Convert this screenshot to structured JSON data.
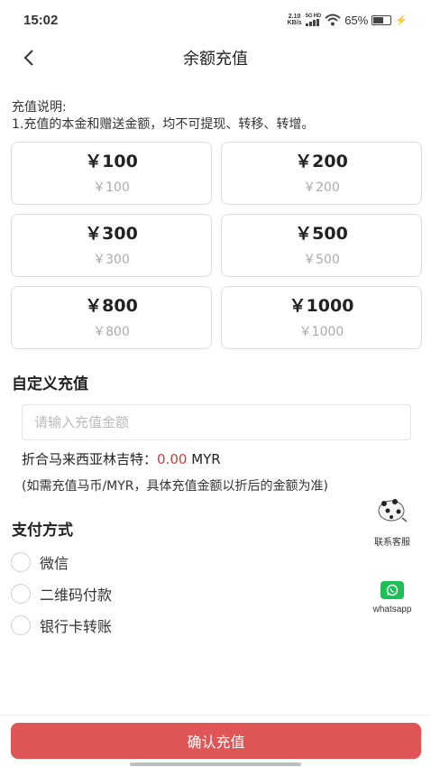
{
  "status_bar": {
    "time": "15:02",
    "net_speed_value": "2.10",
    "net_speed_unit": "KB/s",
    "net_type_top": "5G",
    "net_type_sub": "HD",
    "battery_text": "65%",
    "battery_level": 0.65
  },
  "nav": {
    "back_icon": "chevron-left-icon",
    "title": "余额充值"
  },
  "notice": {
    "heading": "充值说明:",
    "line1": "1.充值的本金和赠送金额，均不可提现、转移、转增。"
  },
  "amounts": [
    {
      "main": "￥100",
      "sub": "￥100"
    },
    {
      "main": "￥200",
      "sub": "￥200"
    },
    {
      "main": "￥300",
      "sub": "￥300"
    },
    {
      "main": "￥500",
      "sub": "￥500"
    },
    {
      "main": "￥800",
      "sub": "￥800"
    },
    {
      "main": "￥1000",
      "sub": "￥1000"
    }
  ],
  "custom": {
    "title": "自定义充值",
    "input_placeholder": "请输入充值金额",
    "input_value": "",
    "convert_label": "折合马来西亚林吉特：",
    "convert_value": "0.00",
    "convert_unit": "MYR",
    "note": "(如需充值马币/MYR，具体充值金额以折后的金额为准)"
  },
  "payment": {
    "title": "支付方式",
    "options": [
      {
        "label": "微信"
      },
      {
        "label": "二维码付款"
      },
      {
        "label": "银行卡转账"
      }
    ]
  },
  "floating": {
    "service_label": "联系客服",
    "service_icon": "customer-service-icon",
    "whatsapp_label": "whatsapp",
    "whatsapp_icon": "whatsapp-icon"
  },
  "footer": {
    "confirm_label": "确认充值"
  },
  "colors": {
    "accent": "#e05555",
    "value_red": "#d23a3a",
    "whatsapp_green": "#1fbf57"
  }
}
